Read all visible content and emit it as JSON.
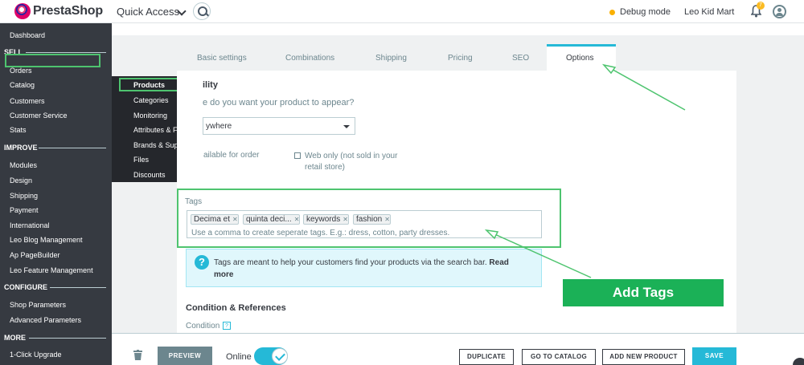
{
  "header": {
    "logo_text": "PrestaShop",
    "quick_access": "Quick Access",
    "debug_mode": "Debug mode",
    "shop_name": "Leo Kid Mart",
    "notification_count": "7"
  },
  "sidebar": {
    "dashboard": "Dashboard",
    "sections": {
      "sell": "SELL",
      "improve": "IMPROVE",
      "configure": "CONFIGURE",
      "more": "MORE"
    },
    "sell_items": [
      "Orders",
      "Catalog",
      "Customers",
      "Customer Service",
      "Stats"
    ],
    "improve_items": [
      "Modules",
      "Design",
      "Shipping",
      "Payment",
      "International",
      "Leo Blog Management",
      "Ap PageBuilder",
      "Leo Feature Management"
    ],
    "configure_items": [
      "Shop Parameters",
      "Advanced Parameters"
    ],
    "more_items": [
      "1-Click Upgrade"
    ]
  },
  "submenu": {
    "items": [
      "Products",
      "Categories",
      "Monitoring",
      "Attributes & Features",
      "Brands & Suppliers",
      "Files",
      "Discounts"
    ]
  },
  "tabs": {
    "items": [
      "Basic settings",
      "Combinations",
      "Shipping",
      "Pricing",
      "SEO"
    ],
    "active": "Options"
  },
  "options": {
    "visibility_title": "ility",
    "visibility_question": "e do you want your product to appear?",
    "visibility_value": "ywhere",
    "available_for_order": "ailable for order",
    "web_only": "Web only (not sold in your retail store)",
    "tags_label": "Tags",
    "tags": [
      "Decima et",
      "quinta deci...",
      "keywords",
      "fashion"
    ],
    "tags_hint": "Use a comma to create seperate tags. E.g.: dress, cotton, party dresses.",
    "info_text": "Tags are meant to help your customers find your products via the search bar.",
    "info_link": "Read more",
    "condition_title": "Condition & References",
    "condition_label": "Condition",
    "condition_help": "?"
  },
  "annotation": {
    "add_tags": "Add Tags",
    "color": "#4ec46f"
  },
  "footer": {
    "preview": "PREVIEW",
    "online": "Online",
    "duplicate": "DUPLICATE",
    "go_to_catalog": "GO TO CATALOG",
    "add_new_product": "ADD NEW PRODUCT",
    "save": "SAVE"
  }
}
